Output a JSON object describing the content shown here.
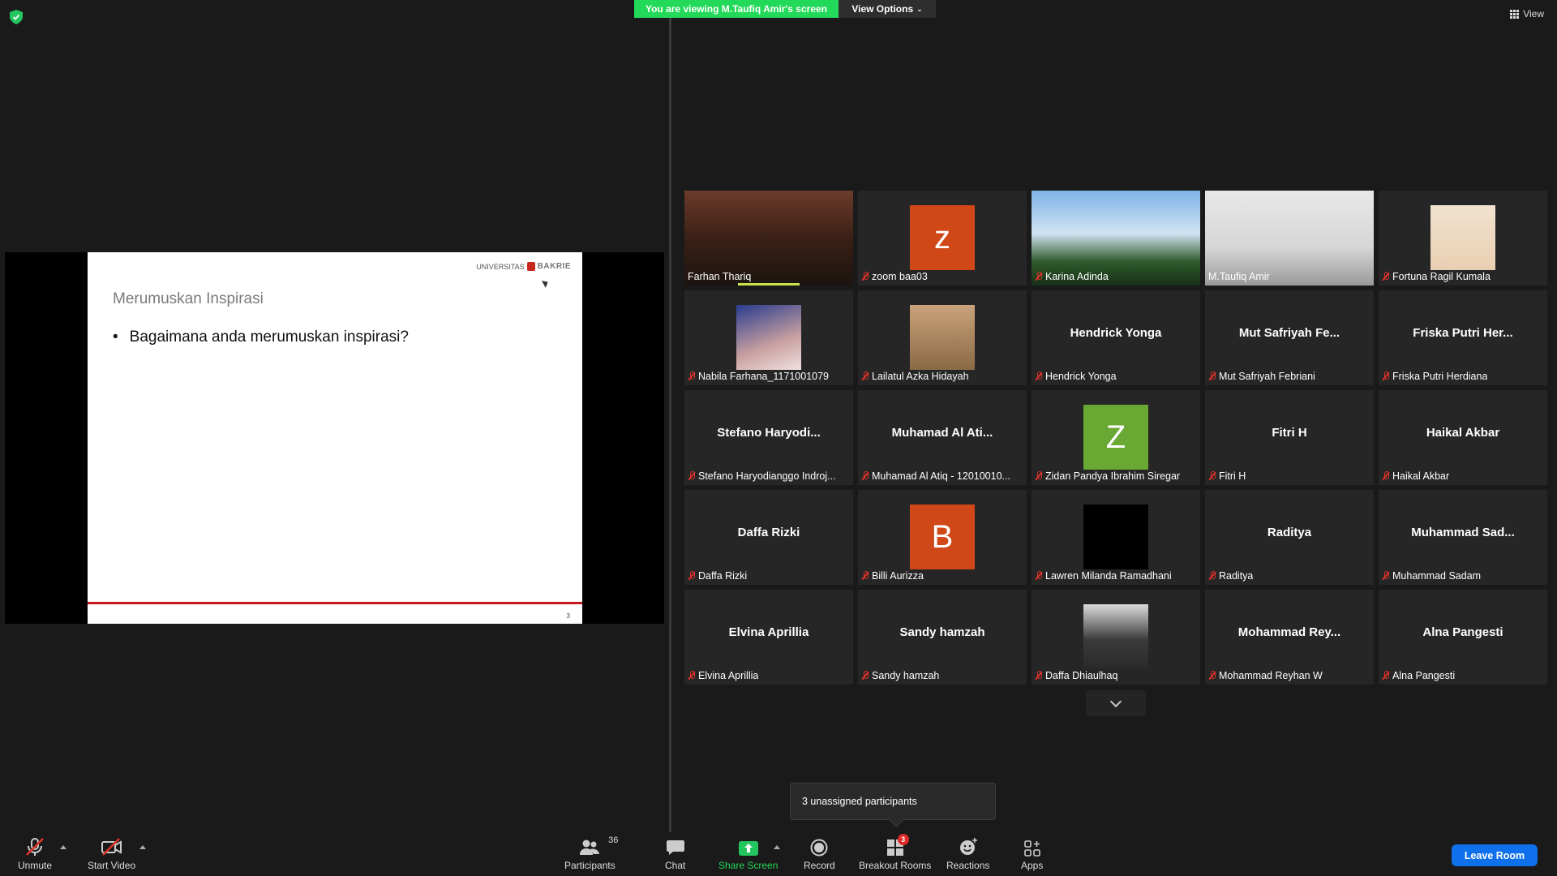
{
  "top": {
    "viewing_banner": "You are viewing M.Taufiq Amir's screen",
    "view_options": "View Options",
    "view": "View"
  },
  "slide": {
    "logo_small": "UNIVERSITAS",
    "logo_brand": "BAKRIE",
    "title": "Merumuskan Inspirasi",
    "bullet": "Bagaimana anda merumuskan inspirasi?",
    "page_number": "3"
  },
  "participants": [
    {
      "name": "Farhan Thariq",
      "display": "",
      "type": "video",
      "muted": false
    },
    {
      "name": "zoom baa03",
      "display": "z",
      "type": "letter",
      "color": "#d04718",
      "muted": true
    },
    {
      "name": "Karina Adinda",
      "display": "",
      "type": "video",
      "muted": true
    },
    {
      "name": "M.Taufiq Amir",
      "display": "",
      "type": "video",
      "muted": false,
      "active": true
    },
    {
      "name": "Fortuna Ragil Kumala",
      "display": "",
      "type": "photo",
      "muted": true
    },
    {
      "name": "Nabila Farhana_1171001079",
      "display": "",
      "type": "photo",
      "muted": true
    },
    {
      "name": "Lailatul Azka Hidayah",
      "display": "",
      "type": "photo",
      "muted": true
    },
    {
      "name": "Hendrick Yonga",
      "display": "Hendrick Yonga",
      "type": "text",
      "muted": true
    },
    {
      "name": "Mut Safriyah Febriani",
      "display": "Mut Safriyah Fe...",
      "type": "text",
      "muted": true
    },
    {
      "name": "Friska Putri Herdiana",
      "display": "Friska Putri Her...",
      "type": "text",
      "muted": true
    },
    {
      "name": "Stefano Haryodianggo Indroj...",
      "display": "Stefano Haryodi...",
      "type": "text",
      "muted": true
    },
    {
      "name": "Muhamad Al Atiq - 12010010...",
      "display": "Muhamad Al Ati...",
      "type": "text",
      "muted": true
    },
    {
      "name": "Zidan Pandya Ibrahim Siregar",
      "display": "Z",
      "type": "letter",
      "color": "#6aa834",
      "muted": true
    },
    {
      "name": "Fitri H",
      "display": "Fitri H",
      "type": "text",
      "muted": true
    },
    {
      "name": "Haikal Akbar",
      "display": "Haikal Akbar",
      "type": "text",
      "muted": true
    },
    {
      "name": "Daffa Rizki",
      "display": "Daffa Rizki",
      "type": "text",
      "muted": true
    },
    {
      "name": "Billi Aurizza",
      "display": "B",
      "type": "letter",
      "color": "#d04718",
      "muted": true
    },
    {
      "name": "Lawren Milanda Ramadhani",
      "display": "",
      "type": "photo",
      "muted": true
    },
    {
      "name": "Raditya",
      "display": "Raditya",
      "type": "text",
      "muted": true
    },
    {
      "name": "Muhammad Sadam",
      "display": "Muhammad Sad...",
      "type": "text",
      "muted": true
    },
    {
      "name": "Elvina Aprillia",
      "display": "Elvina Aprillia",
      "type": "text",
      "muted": true
    },
    {
      "name": "Sandy hamzah",
      "display": "Sandy hamzah",
      "type": "text",
      "muted": true
    },
    {
      "name": "Daffa Dhiaulhaq",
      "display": "",
      "type": "photo",
      "muted": true
    },
    {
      "name": "Mohammad Reyhan W",
      "display": "Mohammad Rey...",
      "type": "text",
      "muted": true
    },
    {
      "name": "Alna Pangesti",
      "display": "Alna Pangesti",
      "type": "text",
      "muted": true
    }
  ],
  "tooltip": "3 unassigned participants",
  "toolbar": {
    "unmute": "Unmute",
    "start_video": "Start Video",
    "participants": "Participants",
    "participants_count": "36",
    "chat": "Chat",
    "share_screen": "Share Screen",
    "record": "Record",
    "breakout_rooms": "Breakout Rooms",
    "breakout_badge": "3",
    "reactions": "Reactions",
    "apps": "Apps",
    "leave_room": "Leave Room"
  },
  "colors": {
    "banner_green": "#23d959",
    "active_speaker": "#d4e86a",
    "leave_blue": "#0e71eb",
    "muted_red": "#e0322b"
  }
}
